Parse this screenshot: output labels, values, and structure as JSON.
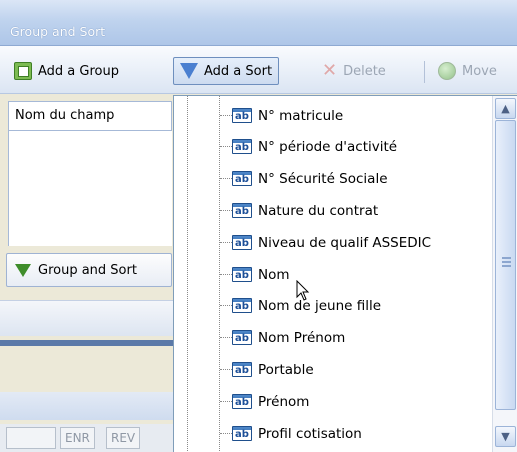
{
  "window": {
    "title": "Group and Sort"
  },
  "toolbar": {
    "add_group_label": "Add a Group",
    "add_sort_label": "Add a Sort",
    "delete_label": "Delete",
    "move_label": "Move"
  },
  "left_panel": {
    "header_label": "Nom du champ",
    "group_sort_label": "Group and Sort",
    "bottom_labels": [
      "ENR",
      "REV"
    ]
  },
  "field_list": {
    "icon_text": "ab",
    "items": [
      "N° matricule",
      "N° période d'activité",
      "N° Sécurité Sociale",
      "Nature du contrat",
      "Niveau de qualif ASSEDIC",
      "Nom",
      "Nom de jeune fille",
      "Nom Prénom",
      "Portable",
      "Prénom",
      "Profil cotisation"
    ]
  },
  "icons": {
    "add_group": "group-add-icon",
    "add_sort": "sort-add-icon",
    "delete": "delete-x-icon",
    "move": "move-icon",
    "group_and_sort": "funnel-icon",
    "field": "text-field-icon"
  },
  "colors": {
    "title_bar": "#bfd3ee",
    "field_icon": "#2d65ab",
    "toolbar_pressed_border": "#6e8fbe"
  }
}
